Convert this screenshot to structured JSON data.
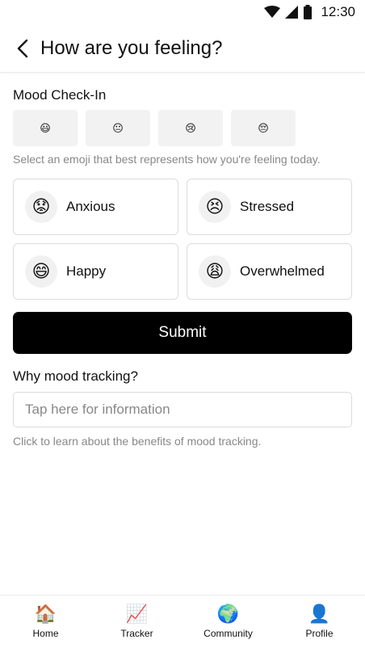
{
  "status_bar": {
    "time": "12:30",
    "icons": [
      "wifi-icon",
      "signal-icon",
      "battery-icon"
    ]
  },
  "header": {
    "back_icon": "chevron-left-icon",
    "title": "How are you feeling?"
  },
  "mood_checkin": {
    "title": "Mood Check-In",
    "emoji_options": [
      "😃",
      "😐",
      "😢",
      "😔"
    ],
    "helper_text": "Select an emoji that best represents how you're feeling today."
  },
  "moods": [
    {
      "emoji": "😟",
      "label": "Anxious"
    },
    {
      "emoji": "😣",
      "label": "Stressed"
    },
    {
      "emoji": "😄",
      "label": "Happy"
    },
    {
      "emoji": "😩",
      "label": "Overwhelmed"
    }
  ],
  "submit_label": "Submit",
  "why": {
    "title": "Why mood tracking?",
    "placeholder": "Tap here for information",
    "helper_text": "Click to learn about the benefits of mood tracking."
  },
  "bottom_nav": [
    {
      "icon": "🏠",
      "label": "Home"
    },
    {
      "icon": "📈",
      "label": "Tracker"
    },
    {
      "icon": "🌍",
      "label": "Community"
    },
    {
      "icon": "👤",
      "label": "Profile"
    }
  ]
}
